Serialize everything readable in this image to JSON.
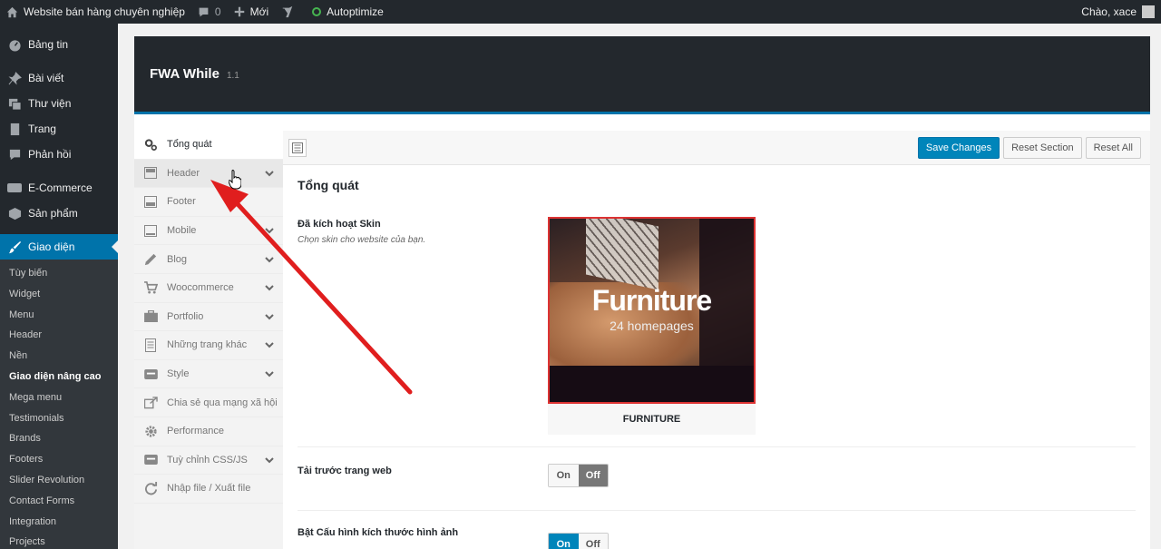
{
  "adminbar": {
    "site_name": "Website bán hàng chuyên nghiệp",
    "comments_count": "0",
    "new_label": "Mới",
    "autoptimize_label": "Autoptimize",
    "greeting": "Chào, xace"
  },
  "sidebar": {
    "items": [
      {
        "label": "Bảng tin",
        "icon": "dashboard-icon"
      },
      {
        "label": "Bài viết",
        "icon": "pin-icon"
      },
      {
        "label": "Thư viện",
        "icon": "media-icon"
      },
      {
        "label": "Trang",
        "icon": "page-icon"
      },
      {
        "label": "Phản hồi",
        "icon": "comment-icon"
      },
      {
        "label": "E-Commerce",
        "icon": "woo-icon"
      },
      {
        "label": "Sản phẩm",
        "icon": "box-icon"
      },
      {
        "label": "Giao diện",
        "icon": "brush-icon"
      }
    ],
    "submenu": [
      "Tùy biến",
      "Widget",
      "Menu",
      "Header",
      "Nền",
      "Giao diện nâng cao",
      "Mega menu",
      "Testimonials",
      "Brands",
      "Footers",
      "Slider Revolution",
      "Contact Forms",
      "Integration",
      "Projects"
    ]
  },
  "panel": {
    "title": "FWA While",
    "version": "1.1"
  },
  "nav": [
    {
      "label": "Tổng quát",
      "icon": "gears-icon"
    },
    {
      "label": "Header",
      "icon": "layout-icon"
    },
    {
      "label": "Footer",
      "icon": "layout-icon"
    },
    {
      "label": "Mobile",
      "icon": "mobile-icon"
    },
    {
      "label": "Blog",
      "icon": "pencil-icon"
    },
    {
      "label": "Woocommerce",
      "icon": "cart-icon"
    },
    {
      "label": "Portfolio",
      "icon": "briefcase-icon"
    },
    {
      "label": "Những trang khác",
      "icon": "document-icon"
    },
    {
      "label": "Style",
      "icon": "css-icon"
    },
    {
      "label": "Chia sẻ qua mạng xã hội",
      "icon": "share-icon"
    },
    {
      "label": "Performance",
      "icon": "cog-icon"
    },
    {
      "label": "Tuỳ chỉnh CSS/JS",
      "icon": "css-icon"
    },
    {
      "label": "Nhập file / Xuất file",
      "icon": "refresh-icon"
    }
  ],
  "toolbar": {
    "save_label": "Save Changes",
    "reset_section_label": "Reset Section",
    "reset_all_label": "Reset All"
  },
  "content": {
    "section_title": "Tổng quát",
    "skin": {
      "title": "Đã kích hoạt Skin",
      "desc": "Chọn skin cho website của bạn.",
      "thumb_name": "Furniture",
      "thumb_sub": "24 homepages",
      "caption": "FURNITURE"
    },
    "preload": {
      "title": "Tải trước trang web",
      "on": "On",
      "off": "Off",
      "selected": "Off"
    },
    "image_size": {
      "title": "Bật Cấu hình kích thước hình ảnh",
      "on": "On",
      "off": "Off",
      "selected": "On"
    }
  },
  "colors": {
    "accent": "#0073aa",
    "arrow": "#e01e1e",
    "adminbar_bg": "#23282d"
  }
}
